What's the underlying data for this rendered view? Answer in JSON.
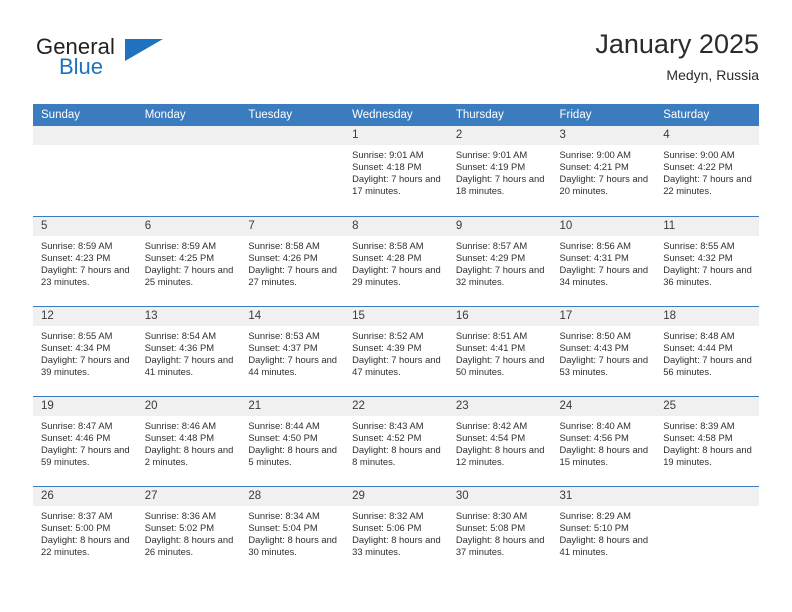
{
  "brand": {
    "name_top": "General",
    "name_bottom": "Blue",
    "accent_color": "#1f72bd"
  },
  "header": {
    "title": "January 2025",
    "location": "Medyn, Russia"
  },
  "calendar": {
    "header_bg": "#3a7cbd",
    "daynum_bg": "#f0f0f0",
    "weekday_names": [
      "Sunday",
      "Monday",
      "Tuesday",
      "Wednesday",
      "Thursday",
      "Friday",
      "Saturday"
    ],
    "weeks": [
      [
        {
          "day": ""
        },
        {
          "day": ""
        },
        {
          "day": ""
        },
        {
          "day": "1",
          "sunrise": "Sunrise: 9:01 AM",
          "sunset": "Sunset: 4:18 PM",
          "daylight": "Daylight: 7 hours and 17 minutes."
        },
        {
          "day": "2",
          "sunrise": "Sunrise: 9:01 AM",
          "sunset": "Sunset: 4:19 PM",
          "daylight": "Daylight: 7 hours and 18 minutes."
        },
        {
          "day": "3",
          "sunrise": "Sunrise: 9:00 AM",
          "sunset": "Sunset: 4:21 PM",
          "daylight": "Daylight: 7 hours and 20 minutes."
        },
        {
          "day": "4",
          "sunrise": "Sunrise: 9:00 AM",
          "sunset": "Sunset: 4:22 PM",
          "daylight": "Daylight: 7 hours and 22 minutes."
        }
      ],
      [
        {
          "day": "5",
          "sunrise": "Sunrise: 8:59 AM",
          "sunset": "Sunset: 4:23 PM",
          "daylight": "Daylight: 7 hours and 23 minutes."
        },
        {
          "day": "6",
          "sunrise": "Sunrise: 8:59 AM",
          "sunset": "Sunset: 4:25 PM",
          "daylight": "Daylight: 7 hours and 25 minutes."
        },
        {
          "day": "7",
          "sunrise": "Sunrise: 8:58 AM",
          "sunset": "Sunset: 4:26 PM",
          "daylight": "Daylight: 7 hours and 27 minutes."
        },
        {
          "day": "8",
          "sunrise": "Sunrise: 8:58 AM",
          "sunset": "Sunset: 4:28 PM",
          "daylight": "Daylight: 7 hours and 29 minutes."
        },
        {
          "day": "9",
          "sunrise": "Sunrise: 8:57 AM",
          "sunset": "Sunset: 4:29 PM",
          "daylight": "Daylight: 7 hours and 32 minutes."
        },
        {
          "day": "10",
          "sunrise": "Sunrise: 8:56 AM",
          "sunset": "Sunset: 4:31 PM",
          "daylight": "Daylight: 7 hours and 34 minutes."
        },
        {
          "day": "11",
          "sunrise": "Sunrise: 8:55 AM",
          "sunset": "Sunset: 4:32 PM",
          "daylight": "Daylight: 7 hours and 36 minutes."
        }
      ],
      [
        {
          "day": "12",
          "sunrise": "Sunrise: 8:55 AM",
          "sunset": "Sunset: 4:34 PM",
          "daylight": "Daylight: 7 hours and 39 minutes."
        },
        {
          "day": "13",
          "sunrise": "Sunrise: 8:54 AM",
          "sunset": "Sunset: 4:36 PM",
          "daylight": "Daylight: 7 hours and 41 minutes."
        },
        {
          "day": "14",
          "sunrise": "Sunrise: 8:53 AM",
          "sunset": "Sunset: 4:37 PM",
          "daylight": "Daylight: 7 hours and 44 minutes."
        },
        {
          "day": "15",
          "sunrise": "Sunrise: 8:52 AM",
          "sunset": "Sunset: 4:39 PM",
          "daylight": "Daylight: 7 hours and 47 minutes."
        },
        {
          "day": "16",
          "sunrise": "Sunrise: 8:51 AM",
          "sunset": "Sunset: 4:41 PM",
          "daylight": "Daylight: 7 hours and 50 minutes."
        },
        {
          "day": "17",
          "sunrise": "Sunrise: 8:50 AM",
          "sunset": "Sunset: 4:43 PM",
          "daylight": "Daylight: 7 hours and 53 minutes."
        },
        {
          "day": "18",
          "sunrise": "Sunrise: 8:48 AM",
          "sunset": "Sunset: 4:44 PM",
          "daylight": "Daylight: 7 hours and 56 minutes."
        }
      ],
      [
        {
          "day": "19",
          "sunrise": "Sunrise: 8:47 AM",
          "sunset": "Sunset: 4:46 PM",
          "daylight": "Daylight: 7 hours and 59 minutes."
        },
        {
          "day": "20",
          "sunrise": "Sunrise: 8:46 AM",
          "sunset": "Sunset: 4:48 PM",
          "daylight": "Daylight: 8 hours and 2 minutes."
        },
        {
          "day": "21",
          "sunrise": "Sunrise: 8:44 AM",
          "sunset": "Sunset: 4:50 PM",
          "daylight": "Daylight: 8 hours and 5 minutes."
        },
        {
          "day": "22",
          "sunrise": "Sunrise: 8:43 AM",
          "sunset": "Sunset: 4:52 PM",
          "daylight": "Daylight: 8 hours and 8 minutes."
        },
        {
          "day": "23",
          "sunrise": "Sunrise: 8:42 AM",
          "sunset": "Sunset: 4:54 PM",
          "daylight": "Daylight: 8 hours and 12 minutes."
        },
        {
          "day": "24",
          "sunrise": "Sunrise: 8:40 AM",
          "sunset": "Sunset: 4:56 PM",
          "daylight": "Daylight: 8 hours and 15 minutes."
        },
        {
          "day": "25",
          "sunrise": "Sunrise: 8:39 AM",
          "sunset": "Sunset: 4:58 PM",
          "daylight": "Daylight: 8 hours and 19 minutes."
        }
      ],
      [
        {
          "day": "26",
          "sunrise": "Sunrise: 8:37 AM",
          "sunset": "Sunset: 5:00 PM",
          "daylight": "Daylight: 8 hours and 22 minutes."
        },
        {
          "day": "27",
          "sunrise": "Sunrise: 8:36 AM",
          "sunset": "Sunset: 5:02 PM",
          "daylight": "Daylight: 8 hours and 26 minutes."
        },
        {
          "day": "28",
          "sunrise": "Sunrise: 8:34 AM",
          "sunset": "Sunset: 5:04 PM",
          "daylight": "Daylight: 8 hours and 30 minutes."
        },
        {
          "day": "29",
          "sunrise": "Sunrise: 8:32 AM",
          "sunset": "Sunset: 5:06 PM",
          "daylight": "Daylight: 8 hours and 33 minutes."
        },
        {
          "day": "30",
          "sunrise": "Sunrise: 8:30 AM",
          "sunset": "Sunset: 5:08 PM",
          "daylight": "Daylight: 8 hours and 37 minutes."
        },
        {
          "day": "31",
          "sunrise": "Sunrise: 8:29 AM",
          "sunset": "Sunset: 5:10 PM",
          "daylight": "Daylight: 8 hours and 41 minutes."
        },
        {
          "day": ""
        }
      ]
    ]
  }
}
